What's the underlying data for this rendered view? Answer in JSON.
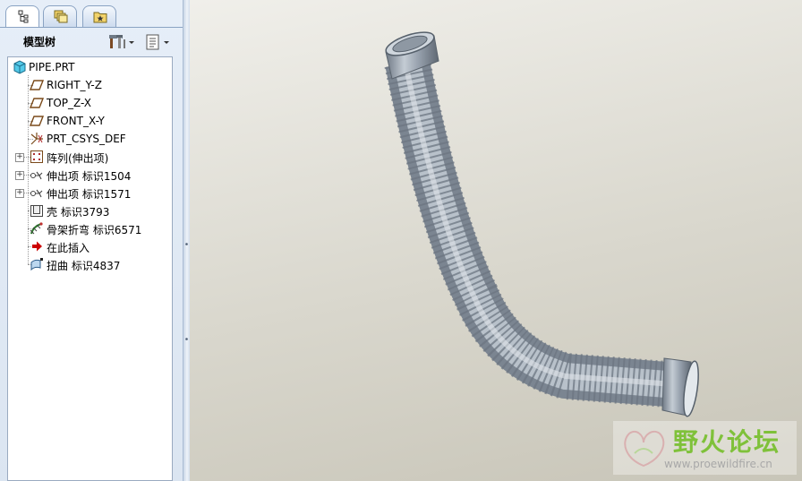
{
  "navigator": {
    "tabs": [
      {
        "name": "model-tree-tab",
        "icon": "tree-structure-icon",
        "active": true
      },
      {
        "name": "folder-browser-tab",
        "icon": "folder-layers-icon",
        "active": false
      },
      {
        "name": "favorites-tab",
        "icon": "favorites-folder-icon",
        "active": false
      }
    ],
    "title": "模型树",
    "settings_icon": "tools-icon",
    "show_icon": "tree-filter-icon"
  },
  "tree": {
    "items": [
      {
        "label": "PIPE.PRT",
        "icon": "part-icon",
        "level": 0,
        "expandable": false
      },
      {
        "label": "RIGHT_Y-Z",
        "icon": "datum-plane-icon",
        "level": 1,
        "expandable": false
      },
      {
        "label": "TOP_Z-X",
        "icon": "datum-plane-icon",
        "level": 1,
        "expandable": false
      },
      {
        "label": "FRONT_X-Y",
        "icon": "datum-plane-icon",
        "level": 1,
        "expandable": false
      },
      {
        "label": "PRT_CSYS_DEF",
        "icon": "coordinate-system-icon",
        "level": 1,
        "expandable": false
      },
      {
        "label": "阵列(伸出项)",
        "icon": "pattern-icon",
        "level": 1,
        "expandable": true
      },
      {
        "label": "伸出项 标识1504",
        "icon": "protrusion-icon",
        "level": 1,
        "expandable": true
      },
      {
        "label": "伸出项 标识1571",
        "icon": "protrusion-icon",
        "level": 1,
        "expandable": true
      },
      {
        "label": "壳 标识3793",
        "icon": "shell-icon",
        "level": 1,
        "expandable": false
      },
      {
        "label": "骨架折弯 标识6571",
        "icon": "spinal-bend-icon",
        "level": 1,
        "expandable": false
      },
      {
        "label": "在此插入",
        "icon": "insert-here-arrow-icon",
        "level": 1,
        "expandable": false
      },
      {
        "label": "扭曲 标识4837",
        "icon": "warp-icon",
        "level": 1,
        "expandable": false
      }
    ]
  },
  "watermark": {
    "title": "野火论坛",
    "url": "www.proewildfire.cn"
  },
  "colors": {
    "viewport_bg": "#d9d7cd",
    "model": "#a7b1bc",
    "selection_arrow": "#cc0000"
  }
}
